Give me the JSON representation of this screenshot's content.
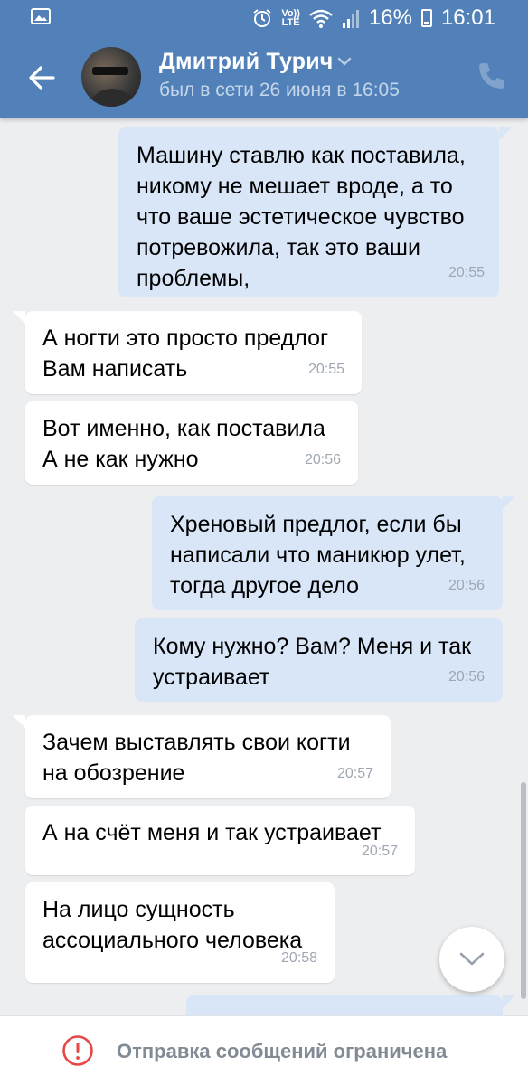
{
  "status_bar": {
    "volte_label": "Vo)) LTE",
    "battery": "16%",
    "time": "16:01",
    "icons": [
      "gallery-icon",
      "alarm-icon",
      "volte-icon",
      "wifi-icon",
      "signal-icon",
      "battery-icon"
    ]
  },
  "header": {
    "name": "Дмитрий Турич",
    "last_seen": "был в сети 26 июня в 16:05",
    "accent": "#5181b8"
  },
  "messages": [
    {
      "dir": "out",
      "lines": [
        "Машину ставлю как поставила,",
        "никому не мешает вроде,  а то",
        "что ваше эстетическое чувство",
        "потревожила,  так это ваши",
        "проблемы,"
      ],
      "time": "20:55"
    },
    {
      "dir": "in",
      "lines": [
        "А ногти это просто предлог",
        "Вам написать"
      ],
      "time": "20:55"
    },
    {
      "dir": "in",
      "lines": [
        "Вот именно, как поставила",
        "А не как нужно"
      ],
      "time": "20:56"
    },
    {
      "dir": "out",
      "lines": [
        "Хреновый предлог,  если бы",
        "написали что маникюр улет,",
        "тогда другое дело"
      ],
      "time": "20:56"
    },
    {
      "dir": "out",
      "lines": [
        "Кому нужно? Вам? Меня и так",
        "устраивает"
      ],
      "time": "20:56"
    },
    {
      "dir": "in",
      "lines": [
        "Зачем выставлять свои когти",
        "на обозрение"
      ],
      "time": "20:57"
    },
    {
      "dir": "in",
      "lines": [
        "А на счёт меня и так устраивает"
      ],
      "time": "20:57"
    },
    {
      "dir": "in",
      "lines": [
        "На лицо сущность",
        "ассоциального человека"
      ],
      "time": "20:58"
    }
  ],
  "footer": {
    "restricted_text": "Отправка сообщений ограничена"
  },
  "colors": {
    "incoming_bubble": "#ffffff",
    "outgoing_bubble": "#d8e6f7",
    "chat_background": "#edeef0",
    "restricted_icon": "#e64646"
  }
}
